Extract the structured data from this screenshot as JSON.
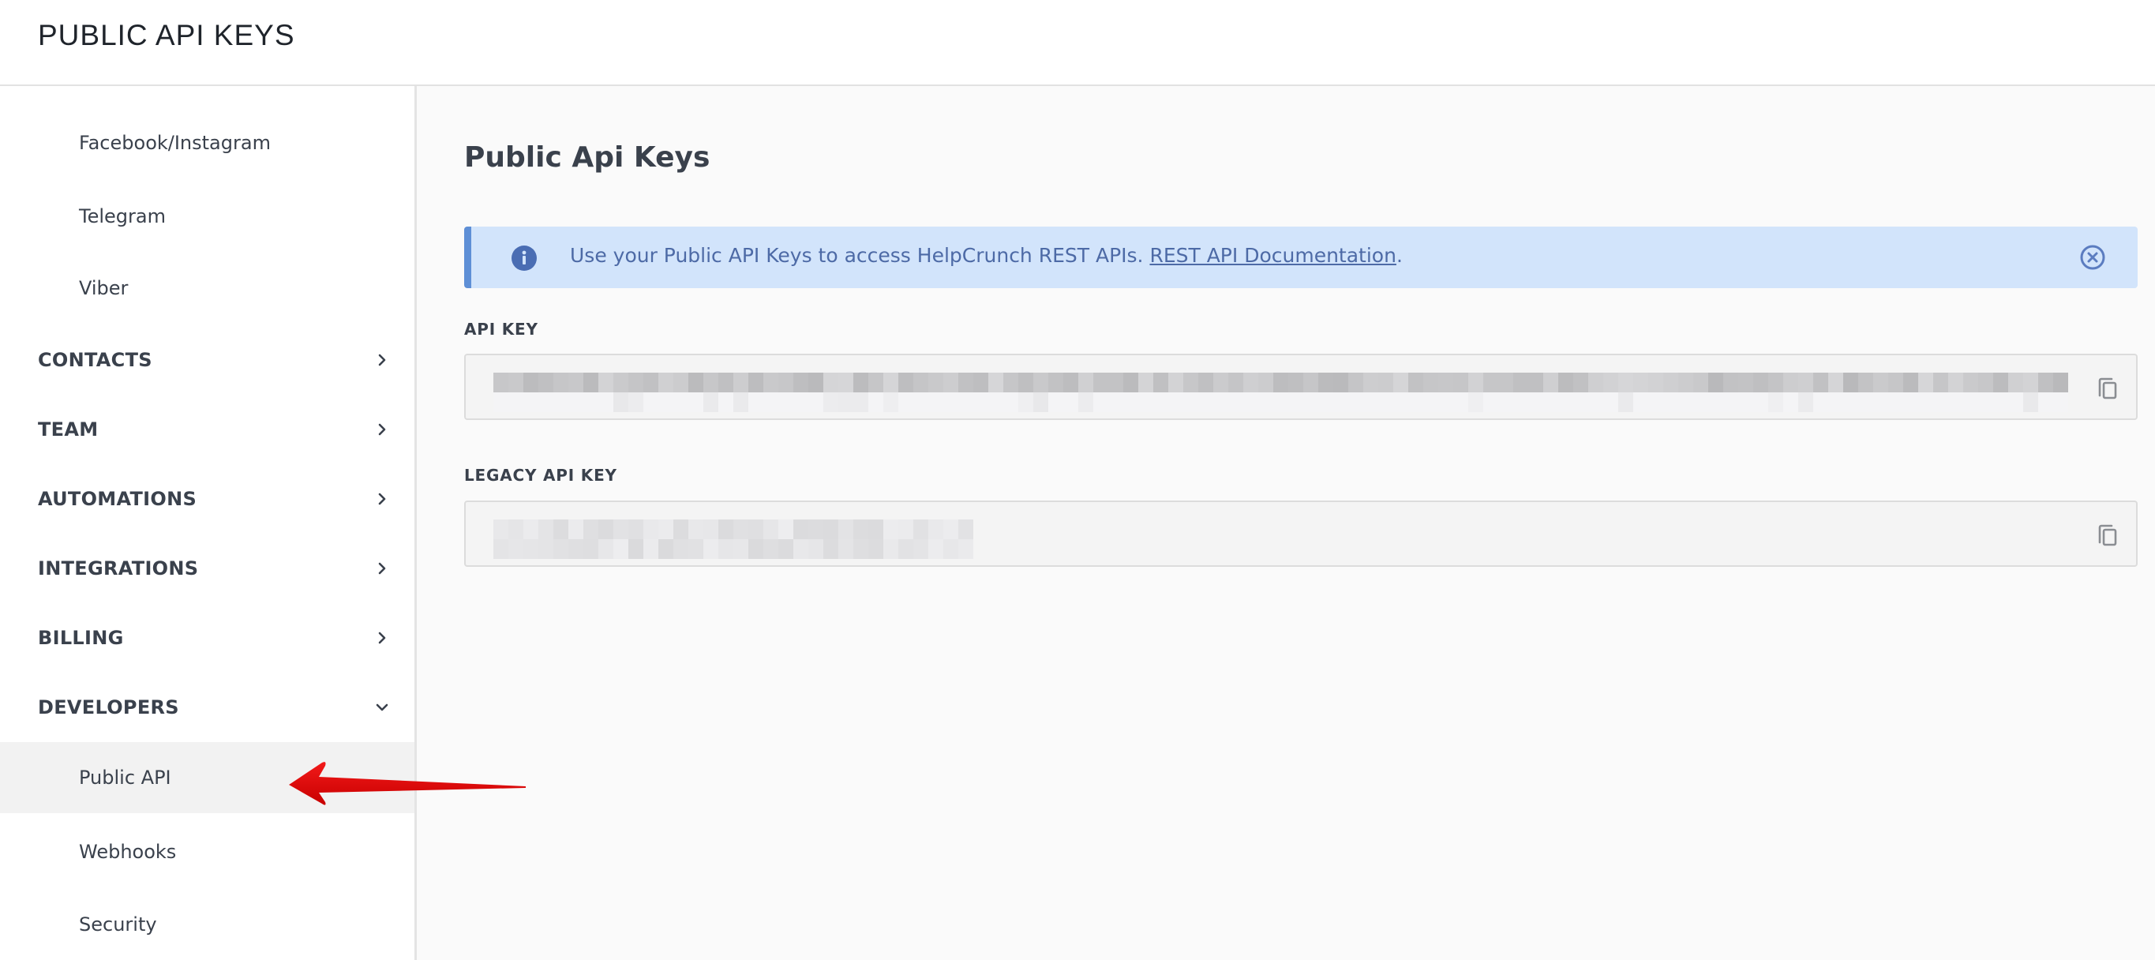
{
  "header": {
    "title": "PUBLIC API KEYS"
  },
  "sidebar": {
    "items": [
      {
        "label": "Facebook/Instagram",
        "level": "sub"
      },
      {
        "label": "Telegram",
        "level": "sub"
      },
      {
        "label": "Viber",
        "level": "sub"
      },
      {
        "label": "CONTACTS",
        "level": "top",
        "icon": "chevron-right-icon"
      },
      {
        "label": "TEAM",
        "level": "top",
        "icon": "chevron-right-icon"
      },
      {
        "label": "AUTOMATIONS",
        "level": "top",
        "icon": "chevron-right-icon"
      },
      {
        "label": "INTEGRATIONS",
        "level": "top",
        "icon": "chevron-right-icon"
      },
      {
        "label": "BILLING",
        "level": "top",
        "icon": "chevron-right-icon"
      },
      {
        "label": "DEVELOPERS",
        "level": "top",
        "icon": "chevron-down-icon",
        "expanded": true
      },
      {
        "label": "Public API",
        "level": "sub",
        "active": true
      },
      {
        "label": "Webhooks",
        "level": "sub"
      },
      {
        "label": "Security",
        "level": "sub"
      }
    ]
  },
  "main": {
    "title": "Public Api Keys",
    "alert": {
      "icon": "info-icon",
      "text": "Use your Public API Keys to access HelpCrunch REST APIs. ",
      "link_label": "REST API Documentation",
      "suffix": ".",
      "close_icon": "close-circle-icon"
    },
    "fields": [
      {
        "label": "API KEY",
        "value_state": "obscured (pixelated)",
        "copy_icon": "copy-icon"
      },
      {
        "label": "LEGACY API KEY",
        "value_state": "obscured (pixelated)",
        "copy_icon": "copy-icon"
      }
    ]
  },
  "annotation": {
    "type": "red-arrow",
    "points_to": "Public API"
  },
  "colors": {
    "alert_bg": "#d2e4fb",
    "alert_border": "#5e8fd6",
    "alert_text": "#4d6aa6",
    "active_item_bg": "#f2f2f2",
    "arrow": "#e30613"
  }
}
